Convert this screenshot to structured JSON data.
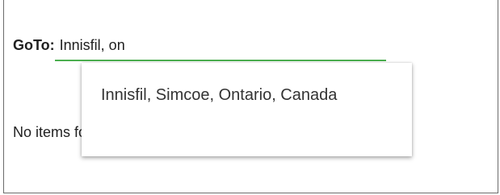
{
  "goto": {
    "label": "GoTo:",
    "value": "Innisfil, on",
    "underline_color": "#4caf50"
  },
  "message": "No items found matching your search terms !",
  "suggestions": [
    "Innisfil, Simcoe, Ontario, Canada"
  ]
}
